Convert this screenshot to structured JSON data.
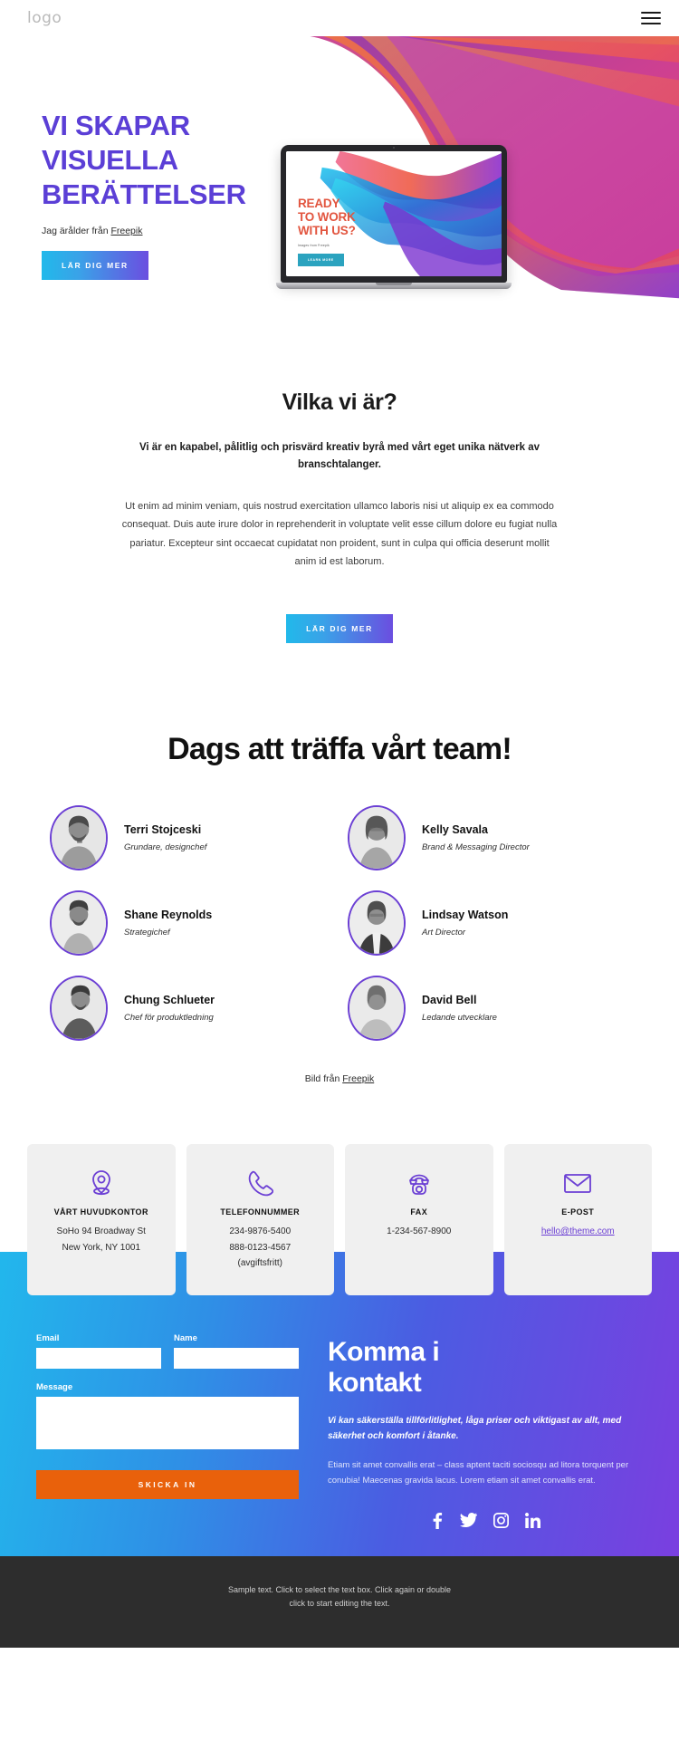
{
  "header": {
    "logo": "logo",
    "menu_icon": "hamburger-menu-icon"
  },
  "hero": {
    "title_line1": "VI SKAPAR",
    "title_line2": "VISUELLA",
    "title_line3": "BERÄTTELSER",
    "credit_prefix": "Jag ärålder från ",
    "credit_link": "Freepik",
    "cta_label": "LÄR DIG MER",
    "accent_color": "#5b3fd6",
    "cta_gradient_from": "#21b9ea",
    "cta_gradient_to": "#6b4ee0",
    "laptop": {
      "headline_line1": "READY",
      "headline_line2": "TO WORK",
      "headline_line3": "WITH US?",
      "sub": "Images from Freepik",
      "button": "LEARN MORE",
      "headline_color": "#e2553f",
      "button_color": "#2ba3bf"
    }
  },
  "who": {
    "title": "Vilka vi är?",
    "lead": "Vi är en kapabel, pålitlig och prisvärd kreativ byrå med vårt eget unika nätverk av branschtalanger.",
    "body": "Ut enim ad minim veniam, quis nostrud exercitation ullamco laboris nisi ut aliquip ex ea commodo consequat. Duis aute irure dolor in reprehenderit in voluptate velit esse cillum dolore eu fugiat nulla pariatur. Excepteur sint occaecat cupidatat non proident, sunt in culpa qui officia deserunt mollit anim id est laborum.",
    "cta_label": "LÄR DIG MER"
  },
  "team": {
    "title": "Dags att träffa vårt team!",
    "members": [
      {
        "name": "Terri Stojceski",
        "role": "Grundare, designchef"
      },
      {
        "name": "Kelly Savala",
        "role": "Brand & Messaging Director"
      },
      {
        "name": "Shane Reynolds",
        "role": "Strategichef"
      },
      {
        "name": "Lindsay Watson",
        "role": "Art Director"
      },
      {
        "name": "Chung Schlueter",
        "role": "Chef för produktledning"
      },
      {
        "name": "David Bell",
        "role": "Ledande utvecklare"
      }
    ],
    "credit_prefix": "Bild från ",
    "credit_link": "Freepik",
    "avatar_border_color": "#6b3fd4"
  },
  "contact_cards": [
    {
      "icon": "location-pin-icon",
      "title": "VÅRT HUVUDKONTOR",
      "lines": [
        "SoHo 94 Broadway St",
        "New York, NY 1001"
      ],
      "link": null
    },
    {
      "icon": "phone-icon",
      "title": "TELEFONNUMMER",
      "lines": [
        "234-9876-5400",
        "888-0123-4567",
        "(avgiftsfritt)"
      ],
      "link": null
    },
    {
      "icon": "fax-icon",
      "title": "FAX",
      "lines": [
        "1-234-567-8900"
      ],
      "link": null
    },
    {
      "icon": "envelope-icon",
      "title": "E-POST",
      "lines": [],
      "link": "hello@theme.com"
    }
  ],
  "form": {
    "email_label": "Email",
    "email_value": "",
    "email_placeholder": "",
    "name_label": "Name",
    "name_value": "",
    "name_placeholder": "",
    "message_label": "Message",
    "message_value": "",
    "message_placeholder": "",
    "submit_label": "SKICKA IN",
    "submit_color": "#e9610b"
  },
  "contact_panel": {
    "title_line1": "Komma i",
    "title_line2": "kontakt",
    "lead": "Vi kan säkerställa tillförlitlighet, låga priser och viktigast av allt, med säkerhet och komfort i åtanke.",
    "body": "Etiam sit amet convallis erat – class aptent taciti sociosqu ad litora torquent per conubia! Maecenas gravida lacus. Lorem etiam sit amet convallis erat.",
    "socials": [
      "facebook-icon",
      "twitter-icon",
      "instagram-icon",
      "linkedin-icon"
    ]
  },
  "footer": {
    "line1": "Sample text. Click to select the text box. Click again or double",
    "line2": "click to start editing the text."
  }
}
